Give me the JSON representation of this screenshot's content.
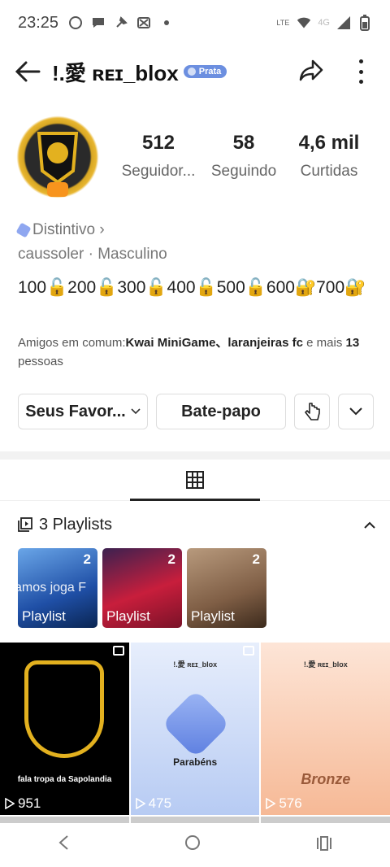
{
  "status_bar": {
    "time": "23:25",
    "network": "4G"
  },
  "header": {
    "title": "!.愛 ʀᴇɪ_blox",
    "badge": "Prata"
  },
  "profile": {
    "stats": [
      {
        "num": "512",
        "label": "Seguidor..."
      },
      {
        "num": "58",
        "label": "Seguindo"
      },
      {
        "num": "4,6 mil",
        "label": "Curtidas"
      }
    ],
    "distintivo": "Distintivo ›",
    "meta": "caussoler · Masculino",
    "bio": "100🔓200🔓300🔓400🔓500🔓600🔐700🔐",
    "mutual_prefix": "Amigos em comum:",
    "mutual_names": "Kwai MiniGame、laranjeiras fc",
    "mutual_middle": " e mais ",
    "mutual_count": "13",
    "mutual_suffix": " pessoas"
  },
  "buttons": {
    "favorites": "Seus Favor...",
    "chat": "Bate-papo"
  },
  "playlists": {
    "title": "3 Playlists",
    "items": [
      {
        "count": "2",
        "label": "Playlist",
        "overlay": "amos joga F"
      },
      {
        "count": "2",
        "label": "Playlist"
      },
      {
        "count": "2",
        "label": "Playlist"
      }
    ]
  },
  "videos": [
    {
      "views": "951",
      "caption": "fala tropa da Sapolandia"
    },
    {
      "views": "475",
      "head": "!.愛 ʀᴇɪ_blox",
      "text": "Parabéns"
    },
    {
      "views": "576",
      "head": "!.愛 ʀᴇɪ_blox",
      "text": "Bronze"
    }
  ]
}
